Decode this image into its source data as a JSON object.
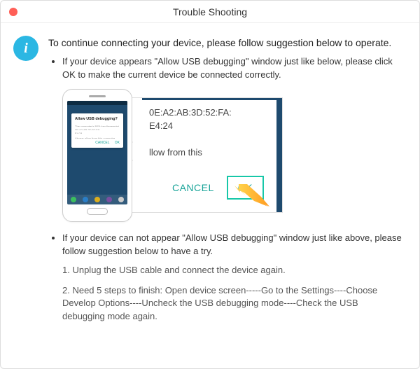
{
  "window": {
    "title": "Trouble Shooting"
  },
  "info_icon_glyph": "i",
  "intro": "To continue connecting your device, please follow suggestion below to operate.",
  "bullets": {
    "first": "If your device appears \"Allow USB debugging\" window just like below, please click OK to make the current device  be connected correctly.",
    "second": "If your device can not appear \"Allow USB debugging\" window just like above, please follow suggestion below to have a try."
  },
  "phone_dialog": {
    "title": "Allow USB debugging?",
    "fingerprint_label": "The computer's RSA key fingerprint is:",
    "mac1": "0E:A2:AB:3D:52:FA:",
    "mac2": "E4:24",
    "always_allow": "Always allow from this computer"
  },
  "zoom": {
    "mac1": "0E:A2:AB:3D:52:FA:",
    "mac2": "E4:24",
    "allow_fragment": "llow from this",
    "cancel": "CANCEL",
    "ok": "OK"
  },
  "steps": {
    "s1": "1. Unplug the USB cable and connect the device again.",
    "s2": "2. Need 5 steps to finish: Open device screen-----Go to the Settings----Choose Develop Options----Uncheck the USB debugging mode----Check the USB debugging mode again."
  }
}
